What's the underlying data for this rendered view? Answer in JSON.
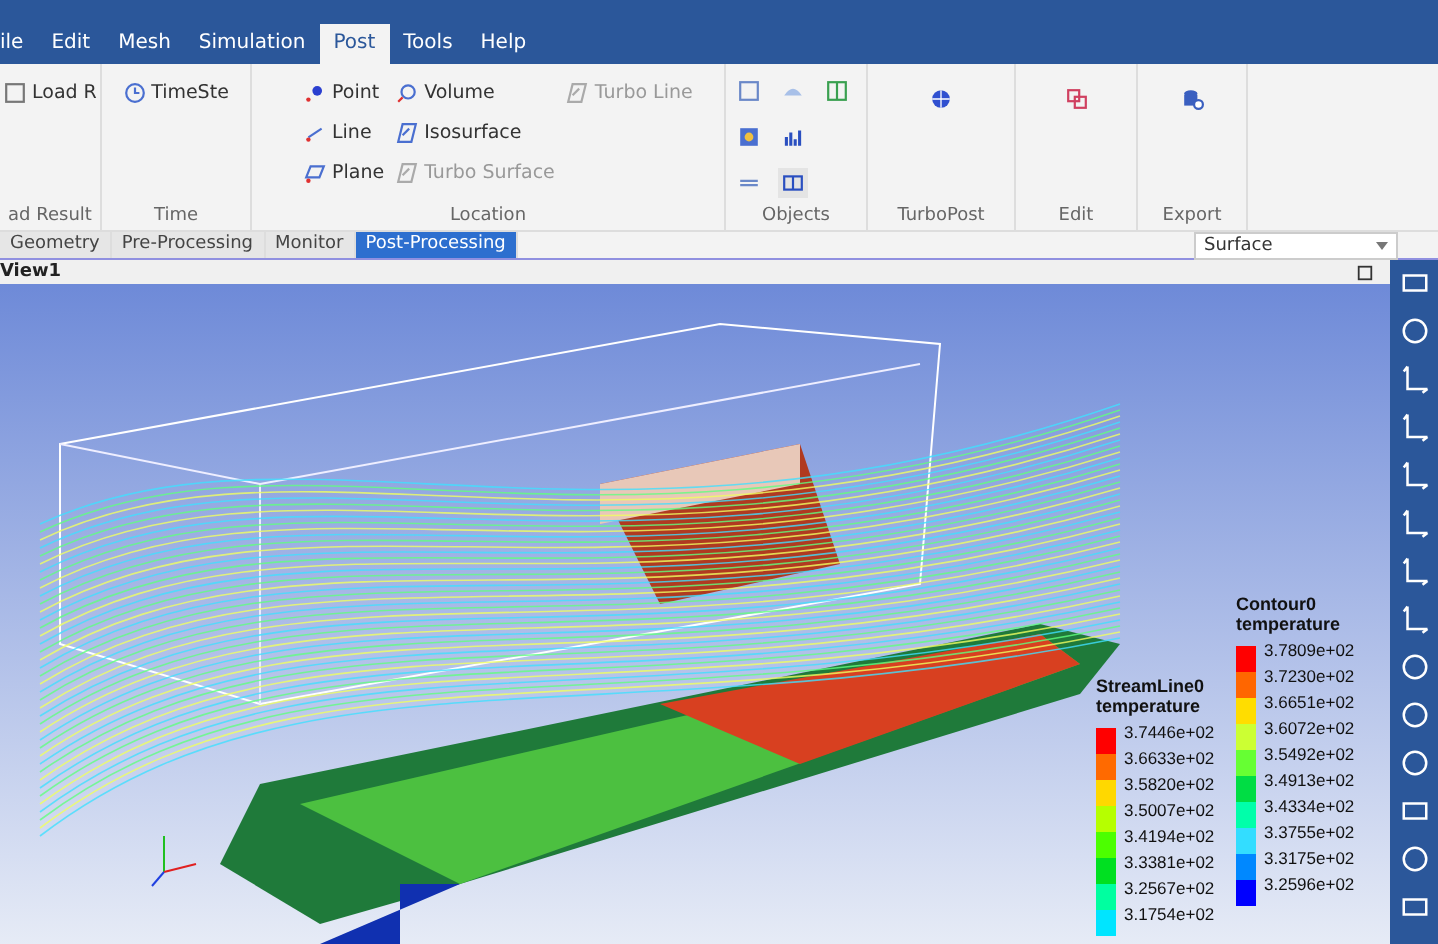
{
  "menu": [
    {
      "label": "ile",
      "selected": false
    },
    {
      "label": "Edit",
      "selected": false
    },
    {
      "label": "Mesh",
      "selected": false
    },
    {
      "label": "Simulation",
      "selected": false
    },
    {
      "label": "Post",
      "selected": true
    },
    {
      "label": "Tools",
      "selected": false
    },
    {
      "label": "Help",
      "selected": false
    }
  ],
  "ribbon": {
    "load": {
      "button": "Load R",
      "group": "ad Result"
    },
    "time": {
      "button": "TimeSte",
      "group": "Time"
    },
    "location": {
      "group": "Location",
      "items": [
        {
          "label": "Point",
          "kind": "point",
          "disabled": false
        },
        {
          "label": "Line",
          "kind": "line",
          "disabled": false
        },
        {
          "label": "Plane",
          "kind": "plane",
          "disabled": false
        },
        {
          "label": "Volume",
          "kind": "volume",
          "disabled": false
        },
        {
          "label": "Isosurface",
          "kind": "iso",
          "disabled": false
        },
        {
          "label": "Turbo Surface",
          "kind": "iso",
          "disabled": true
        },
        {
          "label": "Turbo Line",
          "kind": "iso",
          "disabled": true
        }
      ]
    },
    "objects": {
      "group": "Objects"
    },
    "turbopost": {
      "group": "TurboPost"
    },
    "edit": {
      "group": "Edit"
    },
    "export": {
      "group": "Export"
    }
  },
  "tabs": [
    {
      "label": "Geometry",
      "selected": false
    },
    {
      "label": "Pre-Processing",
      "selected": false
    },
    {
      "label": "Monitor",
      "selected": false
    },
    {
      "label": "Post-Processing",
      "selected": true
    }
  ],
  "display_select": {
    "value": "Surface"
  },
  "view": {
    "title": "View1"
  },
  "legends": [
    {
      "name": "StreamLine0",
      "variable": "temperature",
      "entries": [
        {
          "label": "3.7446e+02",
          "color": "#ff0000"
        },
        {
          "label": "3.6633e+02",
          "color": "#ff6a00"
        },
        {
          "label": "3.5820e+02",
          "color": "#ffd800"
        },
        {
          "label": "3.5007e+02",
          "color": "#b6ff00"
        },
        {
          "label": "3.4194e+02",
          "color": "#4cff00"
        },
        {
          "label": "3.3381e+02",
          "color": "#00e021"
        },
        {
          "label": "3.2567e+02",
          "color": "#00ffa0"
        },
        {
          "label": "3.1754e+02",
          "color": "#00e5ff"
        }
      ]
    },
    {
      "name": "Contour0",
      "variable": "temperature",
      "entries": [
        {
          "label": "3.7809e+02",
          "color": "#ff0000"
        },
        {
          "label": "3.7230e+02",
          "color": "#ff6600"
        },
        {
          "label": "3.6651e+02",
          "color": "#ffdd00"
        },
        {
          "label": "3.6072e+02",
          "color": "#ccff33"
        },
        {
          "label": "3.5492e+02",
          "color": "#66ff33"
        },
        {
          "label": "3.4913e+02",
          "color": "#00dd44"
        },
        {
          "label": "3.4334e+02",
          "color": "#00ffaa"
        },
        {
          "label": "3.3755e+02",
          "color": "#33ddff"
        },
        {
          "label": "3.3175e+02",
          "color": "#0088ff"
        },
        {
          "label": "3.2596e+02",
          "color": "#0000ff"
        }
      ]
    }
  ]
}
